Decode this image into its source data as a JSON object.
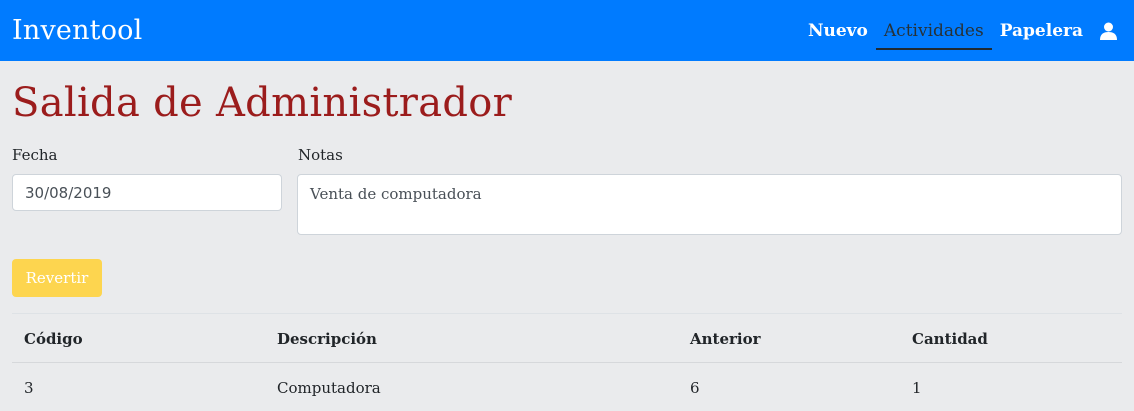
{
  "navbar": {
    "brand": "Inventool",
    "links": [
      {
        "label": "Nuevo",
        "active": false
      },
      {
        "label": "Actividades",
        "active": true
      },
      {
        "label": "Papelera",
        "active": false
      }
    ],
    "user_icon": "user-icon"
  },
  "page": {
    "title": "Salida de Administrador"
  },
  "form": {
    "fecha_label": "Fecha",
    "fecha_value": "30/08/2019",
    "notas_label": "Notas",
    "notas_value": "Venta de computadora",
    "revertir_label": "Revertir"
  },
  "table": {
    "headers": [
      "Código",
      "Descripción",
      "Anterior",
      "Cantidad"
    ],
    "rows": [
      [
        "3",
        "Computadora",
        "6",
        "1"
      ]
    ]
  },
  "colors": {
    "navbar": "#007bff",
    "title": "#9b1c1c",
    "revertir_button": "#fdd54f",
    "background": "#eaebed"
  }
}
